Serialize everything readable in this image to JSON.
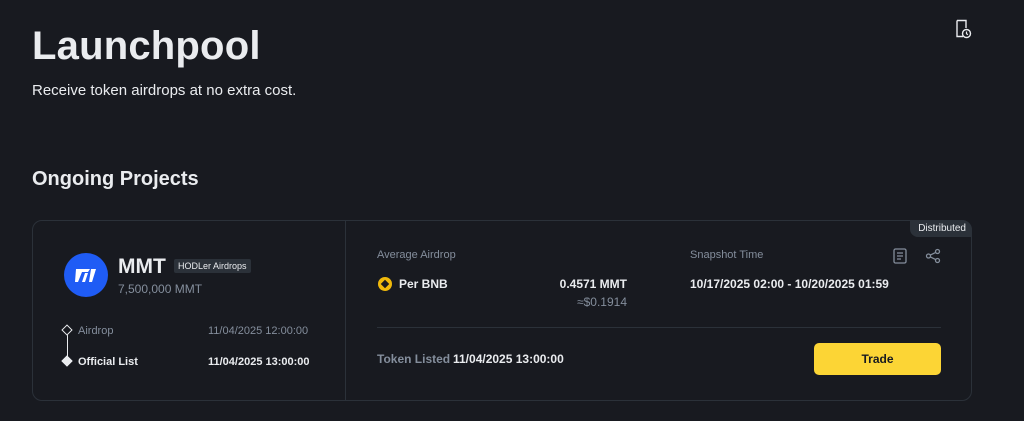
{
  "page": {
    "title": "Launchpool",
    "subtitle": "Receive token airdrops at no extra cost.",
    "history_icon": "history-document-icon"
  },
  "section": {
    "title": "Ongoing Projects"
  },
  "project": {
    "status_badge": "Distributed",
    "token": {
      "name": "MMT",
      "tag": "HODLer Airdrops",
      "supply": "7,500,000 MMT",
      "logo_icon": "mmt-logo-icon",
      "logo_color": "#1f5cf5"
    },
    "timeline": [
      {
        "label": "Airdrop",
        "time": "11/04/2025 12:00:00"
      },
      {
        "label": "Official List",
        "time": "11/04/2025 13:00:00"
      }
    ],
    "average_airdrop": {
      "label": "Average Airdrop",
      "per_label": "Per BNB",
      "amount": "0.4571 MMT",
      "usd_value": "≈$0.1914",
      "coin_icon": "bnb-coin-icon"
    },
    "snapshot": {
      "label": "Snapshot Time",
      "range": "10/17/2025 02:00 - 10/20/2025 01:59"
    },
    "token_listed": {
      "label": "Token Listed",
      "value": "11/04/2025 13:00:00"
    },
    "actions": {
      "trade_label": "Trade",
      "doc_icon": "document-icon",
      "share_icon": "share-icon"
    }
  },
  "colors": {
    "background": "#181a20",
    "border": "#2b3139",
    "text_primary": "#eaecef",
    "text_secondary": "#848e9c",
    "accent_yellow": "#fcd535",
    "bnb_yellow": "#f0b90b"
  }
}
